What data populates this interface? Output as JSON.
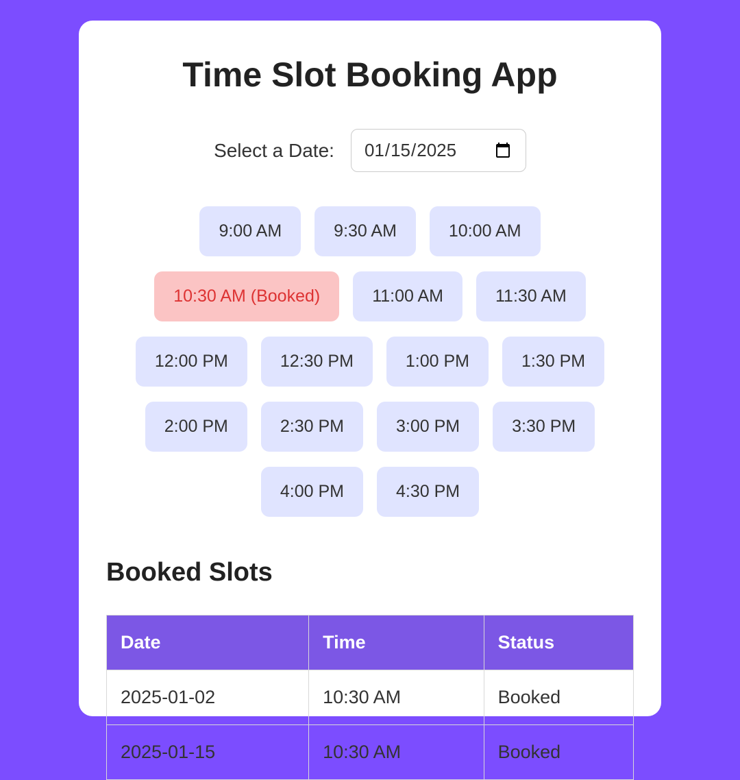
{
  "title": "Time Slot Booking App",
  "date": {
    "label": "Select a Date:",
    "value": "2025-01-15"
  },
  "slots": [
    {
      "label": "9:00 AM",
      "booked": false
    },
    {
      "label": "9:30 AM",
      "booked": false
    },
    {
      "label": "10:00 AM",
      "booked": false
    },
    {
      "label": "10:30 AM (Booked)",
      "booked": true
    },
    {
      "label": "11:00 AM",
      "booked": false
    },
    {
      "label": "11:30 AM",
      "booked": false
    },
    {
      "label": "12:00 PM",
      "booked": false
    },
    {
      "label": "12:30 PM",
      "booked": false
    },
    {
      "label": "1:00 PM",
      "booked": false
    },
    {
      "label": "1:30 PM",
      "booked": false
    },
    {
      "label": "2:00 PM",
      "booked": false
    },
    {
      "label": "2:30 PM",
      "booked": false
    },
    {
      "label": "3:00 PM",
      "booked": false
    },
    {
      "label": "3:30 PM",
      "booked": false
    },
    {
      "label": "4:00 PM",
      "booked": false
    },
    {
      "label": "4:30 PM",
      "booked": false
    }
  ],
  "booked": {
    "heading": "Booked Slots",
    "columns": [
      "Date",
      "Time",
      "Status"
    ],
    "rows": [
      {
        "date": "2025-01-02",
        "time": "10:30 AM",
        "status": "Booked"
      },
      {
        "date": "2025-01-15",
        "time": "10:30 AM",
        "status": "Booked"
      }
    ]
  }
}
